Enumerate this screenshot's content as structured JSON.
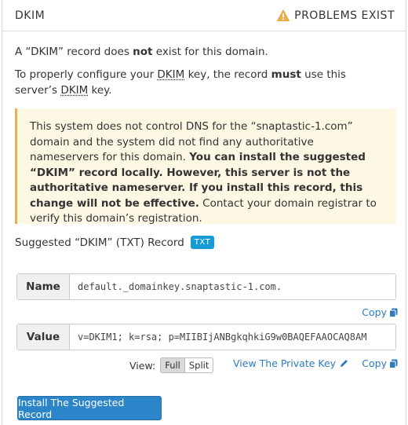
{
  "header": {
    "title": "DKIM",
    "status": "PROBLEMS EXIST",
    "status_icon": "warning-icon",
    "status_color": "#f0ad4e"
  },
  "intro": {
    "line1_pre": "A “DKIM” record does ",
    "line1_bold": "not",
    "line1_post": " exist for this domain.",
    "line2_pre": "To properly configure your ",
    "line2_abbr1": "DKIM",
    "line2_mid": " key, the record ",
    "line2_bold": "must",
    "line2_post": " use this server’s ",
    "line2_abbr2": "DKIM",
    "line2_end": " key."
  },
  "alert": {
    "text_pre": "This system does not control DNS for the “snaptastic-1.com” domain and the system did not find any authoritative nameservers for this domain. ",
    "text_bold": "You can install the suggested “DKIM” record locally. However, this server is not the authoritative nameserver. If you install this record, this change will not be effective.",
    "text_post": " Contact your domain registrar to verify this domain’s registration."
  },
  "suggested": {
    "label": "Suggested “DKIM” (TXT) Record",
    "badge": "TXT"
  },
  "name_field": {
    "label": "Name",
    "value": "default._domainkey.snaptastic-1.com."
  },
  "value_field": {
    "label": "Value",
    "value": "v=DKIM1; k=rsa; p=MIIBIjANBgkqhkiG9w0BAQEFAAOCAQ8AM"
  },
  "copy_label": "Copy",
  "view": {
    "label": "View:",
    "options": [
      "Full",
      "Split"
    ],
    "selected": "Full"
  },
  "private_key_link": "View The Private Key",
  "install_button": "Install The Suggested Record"
}
